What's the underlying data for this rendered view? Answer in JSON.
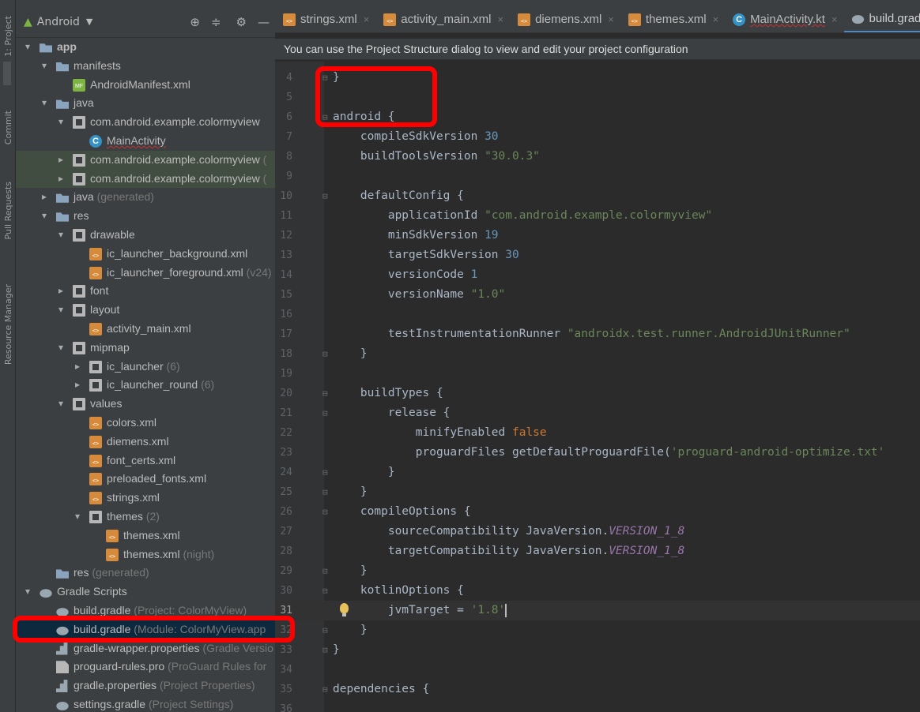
{
  "left_strip": {
    "labels": [
      "1: Project",
      "Commit",
      "Pull Requests",
      "Resource Manager"
    ]
  },
  "project_panel": {
    "view_selector": "Android",
    "tree": [
      {
        "label": "app",
        "icon": "folder",
        "arrow": "▾",
        "depth": 0
      },
      {
        "label": "manifests",
        "icon": "folder",
        "arrow": "▾",
        "depth": 1
      },
      {
        "label": "AndroidManifest.xml",
        "icon": "manifest",
        "arrow": "",
        "depth": 2
      },
      {
        "label": "java",
        "icon": "folder",
        "arrow": "▾",
        "depth": 1
      },
      {
        "label": "com.android.example.colormyview",
        "icon": "pkg",
        "arrow": "▾",
        "depth": 2
      },
      {
        "label": "MainActivity",
        "icon": "kt",
        "arrow": "",
        "depth": 3
      },
      {
        "label": "com.android.example.colormyview",
        "hint": "(",
        "icon": "pkg",
        "arrow": "▸",
        "depth": 2,
        "state": "light"
      },
      {
        "label": "com.android.example.colormyview",
        "hint": "(",
        "icon": "pkg",
        "arrow": "▸",
        "depth": 2,
        "state": "light"
      },
      {
        "label": "java",
        "hint": "(generated)",
        "icon": "folder",
        "arrow": "▸",
        "depth": 1
      },
      {
        "label": "res",
        "icon": "folder",
        "arrow": "▾",
        "depth": 1
      },
      {
        "label": "drawable",
        "icon": "pkg",
        "arrow": "▾",
        "depth": 2
      },
      {
        "label": "ic_launcher_background.xml",
        "icon": "xml",
        "arrow": "",
        "depth": 3
      },
      {
        "label": "ic_launcher_foreground.xml",
        "hint": "(v24)",
        "icon": "xml",
        "arrow": "",
        "depth": 3
      },
      {
        "label": "font",
        "icon": "pkg",
        "arrow": "▸",
        "depth": 2
      },
      {
        "label": "layout",
        "icon": "pkg",
        "arrow": "▾",
        "depth": 2
      },
      {
        "label": "activity_main.xml",
        "icon": "xml",
        "arrow": "",
        "depth": 3
      },
      {
        "label": "mipmap",
        "icon": "pkg",
        "arrow": "▾",
        "depth": 2
      },
      {
        "label": "ic_launcher",
        "hint": "(6)",
        "icon": "pkg",
        "arrow": "▸",
        "depth": 3
      },
      {
        "label": "ic_launcher_round",
        "hint": "(6)",
        "icon": "pkg",
        "arrow": "▸",
        "depth": 3
      },
      {
        "label": "values",
        "icon": "pkg",
        "arrow": "▾",
        "depth": 2
      },
      {
        "label": "colors.xml",
        "icon": "xml",
        "arrow": "",
        "depth": 3
      },
      {
        "label": "diemens.xml",
        "icon": "xml",
        "arrow": "",
        "depth": 3
      },
      {
        "label": "font_certs.xml",
        "icon": "xml",
        "arrow": "",
        "depth": 3
      },
      {
        "label": "preloaded_fonts.xml",
        "icon": "xml",
        "arrow": "",
        "depth": 3
      },
      {
        "label": "strings.xml",
        "icon": "xml",
        "arrow": "",
        "depth": 3
      },
      {
        "label": "themes",
        "hint": "(2)",
        "icon": "pkg",
        "arrow": "▾",
        "depth": 3
      },
      {
        "label": "themes.xml",
        "icon": "xml",
        "arrow": "",
        "depth": 4
      },
      {
        "label": "themes.xml",
        "hint": "(night)",
        "icon": "xml",
        "arrow": "",
        "depth": 4
      },
      {
        "label": "res",
        "hint": "(generated)",
        "icon": "folder",
        "arrow": "",
        "depth": 1
      },
      {
        "label": "Gradle Scripts",
        "icon": "gradle",
        "arrow": "▾",
        "depth": 0
      },
      {
        "label": "build.gradle",
        "hint": "(Project: ColorMyView)",
        "icon": "gradle",
        "arrow": "",
        "depth": 1
      },
      {
        "label": "build.gradle",
        "hint": "(Module: ColorMyView.app",
        "icon": "gradle",
        "arrow": "",
        "depth": 1,
        "state": "selected"
      },
      {
        "label": "gradle-wrapper.properties",
        "hint": "(Gradle Versio",
        "icon": "props",
        "arrow": "",
        "depth": 1
      },
      {
        "label": "proguard-rules.pro",
        "hint": "(ProGuard Rules for",
        "icon": "txt",
        "arrow": "",
        "depth": 1
      },
      {
        "label": "gradle.properties",
        "hint": "(Project Properties)",
        "icon": "props",
        "arrow": "",
        "depth": 1
      },
      {
        "label": "settings.gradle",
        "hint": "(Project Settings)",
        "icon": "gradle",
        "arrow": "",
        "depth": 1
      }
    ]
  },
  "tabs": [
    {
      "label": "strings.xml",
      "icon": "xml",
      "close": "×"
    },
    {
      "label": "activity_main.xml",
      "icon": "xml",
      "close": "×"
    },
    {
      "label": "diemens.xml",
      "icon": "xml",
      "close": "×"
    },
    {
      "label": "themes.xml",
      "icon": "xml",
      "close": "×"
    },
    {
      "label": "MainActivity.kt",
      "icon": "kt",
      "close": "×",
      "underline": true
    },
    {
      "label": "build.gradle",
      "icon": "gradle",
      "close": "×",
      "active": true
    }
  ],
  "banner": "You can use the Project Structure dialog to view and edit your project configuration",
  "code_lines": [
    {
      "n": "4",
      "fold": "⊟",
      "parts": [
        {
          "t": "}",
          "c": ""
        }
      ]
    },
    {
      "n": "5",
      "parts": []
    },
    {
      "n": "6",
      "fold": "⊟",
      "parts": [
        {
          "t": "android {",
          "c": ""
        }
      ]
    },
    {
      "n": "7",
      "parts": [
        {
          "t": "    compileSdkVersion ",
          "c": ""
        },
        {
          "t": "30",
          "c": "num"
        }
      ]
    },
    {
      "n": "8",
      "parts": [
        {
          "t": "    buildToolsVersion ",
          "c": ""
        },
        {
          "t": "\"30.0.3\"",
          "c": "str"
        }
      ]
    },
    {
      "n": "9",
      "parts": []
    },
    {
      "n": "10",
      "fold": "⊟",
      "parts": [
        {
          "t": "    defaultConfig {",
          "c": ""
        }
      ]
    },
    {
      "n": "11",
      "parts": [
        {
          "t": "        applicationId ",
          "c": ""
        },
        {
          "t": "\"com.android.example.colormyview\"",
          "c": "str"
        }
      ]
    },
    {
      "n": "12",
      "parts": [
        {
          "t": "        minSdkVersion ",
          "c": ""
        },
        {
          "t": "19",
          "c": "num"
        }
      ]
    },
    {
      "n": "13",
      "parts": [
        {
          "t": "        targetSdkVersion ",
          "c": ""
        },
        {
          "t": "30",
          "c": "num"
        }
      ]
    },
    {
      "n": "14",
      "parts": [
        {
          "t": "        versionCode ",
          "c": ""
        },
        {
          "t": "1",
          "c": "num"
        }
      ]
    },
    {
      "n": "15",
      "parts": [
        {
          "t": "        versionName ",
          "c": ""
        },
        {
          "t": "\"1.0\"",
          "c": "str"
        }
      ]
    },
    {
      "n": "16",
      "parts": []
    },
    {
      "n": "17",
      "parts": [
        {
          "t": "        testInstrumentationRunner ",
          "c": ""
        },
        {
          "t": "\"androidx.test.runner.AndroidJUnitRunner\"",
          "c": "str"
        }
      ]
    },
    {
      "n": "18",
      "fold": "⊟",
      "parts": [
        {
          "t": "    }",
          "c": ""
        }
      ]
    },
    {
      "n": "19",
      "parts": []
    },
    {
      "n": "20",
      "fold": "⊟",
      "parts": [
        {
          "t": "    buildTypes {",
          "c": ""
        }
      ]
    },
    {
      "n": "21",
      "fold": "⊟",
      "parts": [
        {
          "t": "        release {",
          "c": ""
        }
      ]
    },
    {
      "n": "22",
      "parts": [
        {
          "t": "            minifyEnabled ",
          "c": ""
        },
        {
          "t": "false",
          "c": "kw"
        }
      ]
    },
    {
      "n": "23",
      "parts": [
        {
          "t": "            proguardFiles getDefaultProguardFile(",
          "c": ""
        },
        {
          "t": "'proguard-android-optimize.txt'",
          "c": "str"
        }
      ]
    },
    {
      "n": "24",
      "fold": "⊟",
      "parts": [
        {
          "t": "        }",
          "c": ""
        }
      ]
    },
    {
      "n": "25",
      "fold": "⊟",
      "parts": [
        {
          "t": "    }",
          "c": ""
        }
      ]
    },
    {
      "n": "26",
      "fold": "⊟",
      "parts": [
        {
          "t": "    compileOptions {",
          "c": ""
        }
      ]
    },
    {
      "n": "27",
      "parts": [
        {
          "t": "        sourceCompatibility JavaVersion.",
          "c": ""
        },
        {
          "t": "VERSION_1_8",
          "c": "fld"
        }
      ]
    },
    {
      "n": "28",
      "parts": [
        {
          "t": "        targetCompatibility JavaVersion.",
          "c": ""
        },
        {
          "t": "VERSION_1_8",
          "c": "fld"
        }
      ]
    },
    {
      "n": "29",
      "fold": "⊟",
      "parts": [
        {
          "t": "    }",
          "c": ""
        }
      ]
    },
    {
      "n": "30",
      "fold": "⊟",
      "parts": [
        {
          "t": "    kotlinOptions {",
          "c": ""
        }
      ]
    },
    {
      "n": "31",
      "caret": true,
      "bulb": true,
      "parts": [
        {
          "t": "        jvmTarget = ",
          "c": ""
        },
        {
          "t": "'1.8'",
          "c": "str"
        }
      ]
    },
    {
      "n": "32",
      "fold": "⊟",
      "parts": [
        {
          "t": "    }",
          "c": ""
        }
      ]
    },
    {
      "n": "33",
      "fold": "⊟",
      "parts": [
        {
          "t": "}",
          "c": ""
        }
      ]
    },
    {
      "n": "34",
      "parts": []
    },
    {
      "n": "35",
      "fold": "⊟",
      "parts": [
        {
          "t": "dependencies {",
          "c": ""
        }
      ]
    },
    {
      "n": "36",
      "parts": []
    }
  ],
  "colors": {
    "highlight": "#ff0000",
    "selection": "#0d293e",
    "accent": "#4a88c7"
  }
}
